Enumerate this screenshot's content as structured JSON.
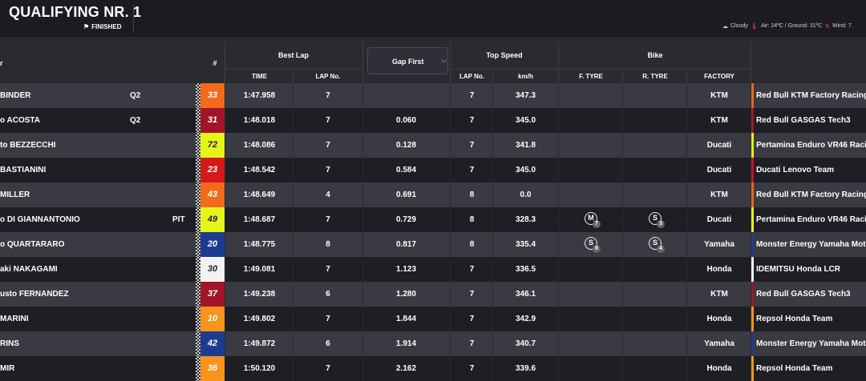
{
  "header": {
    "title": "QUALIFYING NR. 1",
    "status": "FINISHED",
    "weather": {
      "condition": "Cloudy",
      "air_ground": "Air: 24ºC / Ground: 31ºC",
      "wind": "Wind: 7."
    }
  },
  "columns": {
    "rider": "r",
    "number": "#",
    "best_lap": "Best Lap",
    "time": "TIME",
    "lap_no": "LAP No.",
    "gap_select": "Gap First",
    "top_speed": "Top Speed",
    "ts_lap_no": "LAP No.",
    "kmh": "km/h",
    "bike": "Bike",
    "f_tyre": "F. TYRE",
    "r_tyre": "R. TYRE",
    "factory": "FACTORY"
  },
  "colors": {
    "row_light": "#3a3b42",
    "row_dark": "#1e1f24",
    "background": "#2a2b31"
  },
  "rows": [
    {
      "name": "BINDER",
      "session": "Q2",
      "pit": "",
      "number": "33",
      "num_bg": "#f26b1d",
      "num_fg": "#ffffff",
      "time": "1:47.958",
      "lap": "7",
      "gap": "",
      "ts_lap": "7",
      "speed": "347.3",
      "f_tyre": null,
      "r_tyre": null,
      "factory": "KTM",
      "team": "Red Bull KTM Factory Racing",
      "team_color": "#e8661c"
    },
    {
      "name": "o ACOSTA",
      "session": "Q2",
      "pit": "",
      "number": "31",
      "num_bg": "#a0152a",
      "num_fg": "#ffffff",
      "time": "1:48.018",
      "lap": "7",
      "gap": "0.060",
      "ts_lap": "7",
      "speed": "345.0",
      "f_tyre": null,
      "r_tyre": null,
      "factory": "KTM",
      "team": "Red Bull GASGAS Tech3",
      "team_color": "#a0152a"
    },
    {
      "name": "to BEZZECCHI",
      "session": "",
      "pit": "",
      "number": "72",
      "num_bg": "#e5f51c",
      "num_fg": "#222222",
      "time": "1:48.086",
      "lap": "7",
      "gap": "0.128",
      "ts_lap": "7",
      "speed": "341.8",
      "f_tyre": null,
      "r_tyre": null,
      "factory": "Ducati",
      "team": "Pertamina Enduro VR46 Racin",
      "team_color": "#e5f51c"
    },
    {
      "name": "BASTIANINI",
      "session": "",
      "pit": "",
      "number": "23",
      "num_bg": "#d31a1a",
      "num_fg": "#ffffff",
      "time": "1:48.542",
      "lap": "7",
      "gap": "0.584",
      "ts_lap": "7",
      "speed": "345.0",
      "f_tyre": null,
      "r_tyre": null,
      "factory": "Ducati",
      "team": "Ducati Lenovo Team",
      "team_color": "#c8102e"
    },
    {
      "name": "MILLER",
      "session": "",
      "pit": "",
      "number": "43",
      "num_bg": "#f26b1d",
      "num_fg": "#ffffff",
      "time": "1:48.649",
      "lap": "4",
      "gap": "0.691",
      "ts_lap": "8",
      "speed": "0.0",
      "f_tyre": null,
      "r_tyre": null,
      "factory": "KTM",
      "team": "Red Bull KTM Factory Racing",
      "team_color": "#e8661c"
    },
    {
      "name": "o DI GIANNANTONIO",
      "session": "",
      "pit": "PIT",
      "number": "49",
      "num_bg": "#e5f51c",
      "num_fg": "#222222",
      "time": "1:48.687",
      "lap": "7",
      "gap": "0.729",
      "ts_lap": "8",
      "speed": "328.3",
      "f_tyre": {
        "letter": "M",
        "lap": "7"
      },
      "r_tyre": {
        "letter": "S",
        "lap": "3"
      },
      "factory": "Ducati",
      "team": "Pertamina Enduro VR46 Racin",
      "team_color": "#e5f51c"
    },
    {
      "name": "o QUARTARARO",
      "session": "",
      "pit": "",
      "number": "20",
      "num_bg": "#1f3b8f",
      "num_fg": "#ffffff",
      "time": "1:48.775",
      "lap": "8",
      "gap": "0.817",
      "ts_lap": "8",
      "speed": "335.4",
      "f_tyre": {
        "letter": "S",
        "lap": "8"
      },
      "r_tyre": {
        "letter": "S",
        "lap": "4"
      },
      "factory": "Yamaha",
      "team": "Monster Energy Yamaha Moto",
      "team_color": "#1f3b8f"
    },
    {
      "name": "aki NAKAGAMI",
      "session": "",
      "pit": "",
      "number": "30",
      "num_bg": "#f2f2f2",
      "num_fg": "#222222",
      "time": "1:49.081",
      "lap": "7",
      "gap": "1.123",
      "ts_lap": "7",
      "speed": "336.5",
      "f_tyre": null,
      "r_tyre": null,
      "factory": "Honda",
      "team": "IDEMITSU Honda LCR",
      "team_color": "#f2f2f2"
    },
    {
      "name": "usto FERNANDEZ",
      "session": "",
      "pit": "",
      "number": "37",
      "num_bg": "#a0152a",
      "num_fg": "#ffffff",
      "time": "1:49.238",
      "lap": "6",
      "gap": "1.280",
      "ts_lap": "7",
      "speed": "346.1",
      "f_tyre": null,
      "r_tyre": null,
      "factory": "KTM",
      "team": "Red Bull GASGAS Tech3",
      "team_color": "#a0152a"
    },
    {
      "name": "MARINI",
      "session": "",
      "pit": "",
      "number": "10",
      "num_bg": "#f7941d",
      "num_fg": "#ffffff",
      "time": "1:49.802",
      "lap": "7",
      "gap": "1.844",
      "ts_lap": "7",
      "speed": "342.9",
      "f_tyre": null,
      "r_tyre": null,
      "factory": "Honda",
      "team": "Repsol Honda Team",
      "team_color": "#f7941d"
    },
    {
      "name": "RINS",
      "session": "",
      "pit": "",
      "number": "42",
      "num_bg": "#1f3b8f",
      "num_fg": "#ffffff",
      "time": "1:49.872",
      "lap": "6",
      "gap": "1.914",
      "ts_lap": "7",
      "speed": "340.7",
      "f_tyre": null,
      "r_tyre": null,
      "factory": "Yamaha",
      "team": "Monster Energy Yamaha Moto",
      "team_color": "#1f3b8f"
    },
    {
      "name": "MIR",
      "session": "",
      "pit": "",
      "number": "36",
      "num_bg": "#f7941d",
      "num_fg": "#ffffff",
      "time": "1:50.120",
      "lap": "7",
      "gap": "2.162",
      "ts_lap": "7",
      "speed": "339.6",
      "f_tyre": null,
      "r_tyre": null,
      "factory": "Honda",
      "team": "Repsol Honda Team",
      "team_color": "#f7941d"
    }
  ]
}
